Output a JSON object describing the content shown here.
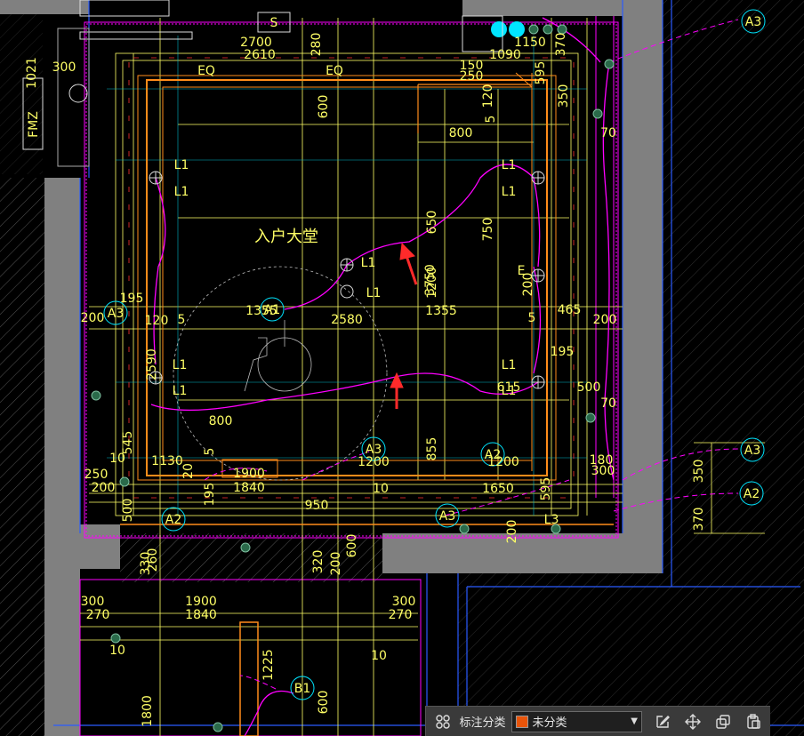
{
  "drawing": {
    "room_label": "入户大堂",
    "colors": {
      "background": "#000000",
      "wall_fill": "#808080",
      "orange_line": "#ff8c1a",
      "yellow_dim": "#ffff66",
      "magenta": "#ff00ff",
      "cyan": "#00e5ff",
      "blue_line": "#2a5bff",
      "red_arrow": "#ff2a2a",
      "white": "#dddddd"
    },
    "dimensions": [
      "2700",
      "2610",
      "280",
      "1150",
      "1090",
      "370",
      "300",
      "1021",
      "150",
      "250",
      "EQ",
      "EQ",
      "595",
      "120",
      "350",
      "600",
      "800",
      "5",
      "70",
      "L1",
      "L1",
      "L1",
      "L1",
      "650",
      "750",
      "1200",
      "3750",
      "L1",
      "L1",
      "195",
      "465",
      "200",
      "1355",
      "2580",
      "1355",
      "200",
      "5",
      "5",
      "120",
      "200",
      "L1",
      "L1",
      "L1",
      "L1",
      "615",
      "195",
      "500",
      "2590",
      "800",
      "5",
      "70",
      "545",
      "855",
      "10",
      "1130",
      "20",
      "1900",
      "1840",
      "195",
      "1200",
      "1200",
      "180",
      "300",
      "250",
      "200",
      "10",
      "1650",
      "595",
      "500",
      "950",
      "L3",
      "200",
      "330",
      "260",
      "320",
      "200",
      "600",
      "300",
      "270",
      "1900",
      "1840",
      "300",
      "270",
      "10",
      "10",
      "1225",
      "600",
      "1800",
      "350",
      "370",
      "E",
      "FMZ"
    ],
    "callouts": {
      "a1": "A1",
      "a2_left": "A2",
      "a2_right": "A2",
      "a2_top": "A2",
      "a3_top_right": "A3",
      "a3_mid": "A3",
      "a3_right": "A3",
      "a3_bottom": "A3",
      "a3_left": "A3",
      "b1": "B1",
      "s": "S"
    }
  },
  "toolbar": {
    "grid_icon": "four-circles-icon",
    "label": "标注分类",
    "select_value": "未分类",
    "select_color": "#e8540a",
    "icons": [
      "edit-icon",
      "move-icon",
      "copy-icon",
      "paste-icon"
    ]
  }
}
